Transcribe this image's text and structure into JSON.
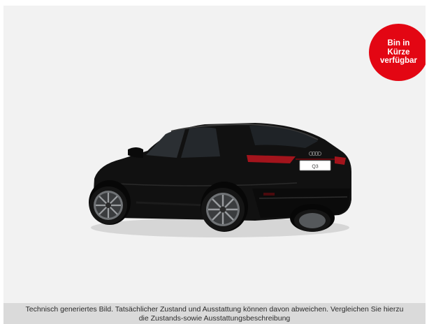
{
  "badge": {
    "line1": "Bin in",
    "line2": "Kürze",
    "line3": "verfügbar",
    "color": "#e30613"
  },
  "car_image": {
    "plate_text": "Q3",
    "body_color": "#111111"
  },
  "disclaimer": {
    "line1": "Technisch generiertes Bild. Tatsächlicher Zustand und Ausstattung können davon abweichen. Vergleichen Sie hierzu",
    "line2": "die Zustands-sowie Ausstattungsbeschreibung"
  }
}
